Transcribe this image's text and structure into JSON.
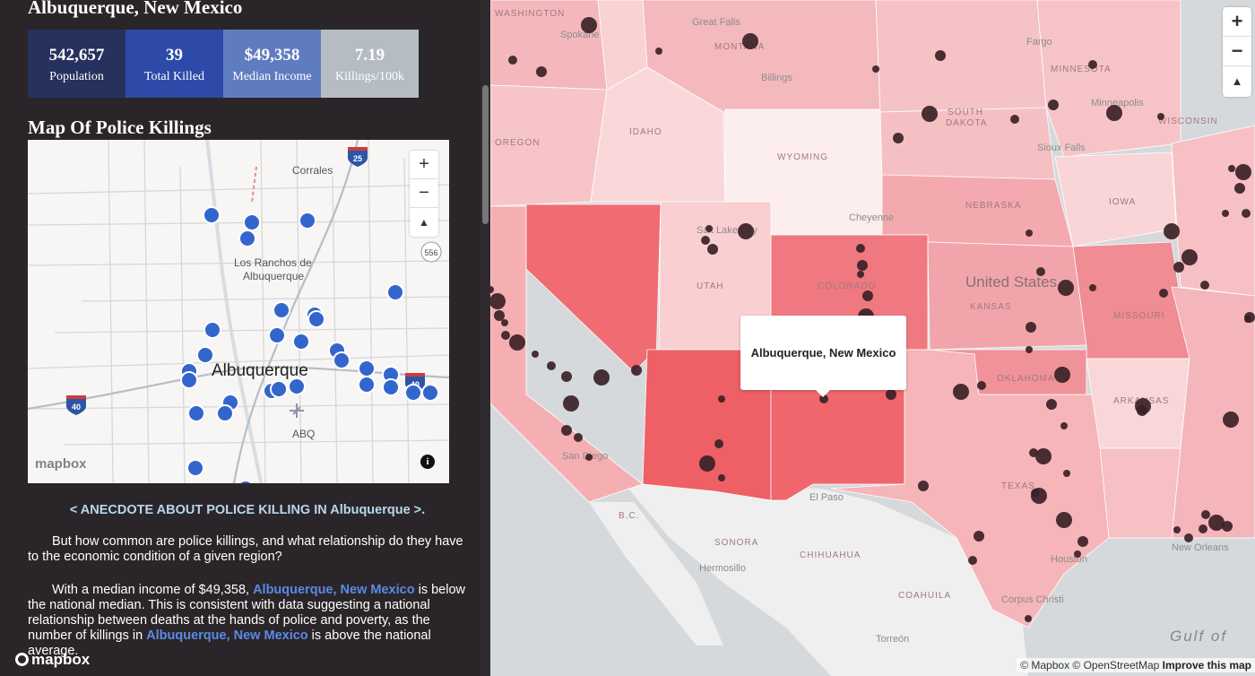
{
  "city": {
    "title": "Albuquerque, New Mexico"
  },
  "stats": [
    {
      "value": "542,657",
      "label": "Population",
      "color": "#27315e"
    },
    {
      "value": "39",
      "label": "Total Killed",
      "color": "#2d4aa8"
    },
    {
      "value": "$49,358",
      "label": "Median Income",
      "color": "#5f7cc0"
    },
    {
      "value": "7.19",
      "label": "Killings/100k",
      "color": "#b5bcc3"
    }
  ],
  "section_title": "Map Of Police Killings",
  "mini_map": {
    "labels": {
      "corrales": "Corrales",
      "los_ranchos_1": "Los Ranchos de",
      "los_ranchos_2": "Albuquerque",
      "albuquerque": "Albuquerque",
      "abq": "ABQ",
      "highway_25": "25",
      "highway_40a": "40",
      "highway_40b": "40",
      "highway_556": "556"
    },
    "zoom_in": "+",
    "zoom_out": "−",
    "compass": "▲",
    "logo": "mapbox",
    "info": "i",
    "marker_color": "#3366cc"
  },
  "anecdote": "< ANECDOTE ABOUT POLICE KILLING IN Albuquerque >.",
  "paragraphs": {
    "p1": "But how common are police killings, and what relationship do they have to the economic condition of a given region?",
    "p2_a": "With a median income of $49,358, ",
    "p2_link1": "Albuquerque, New Mexico",
    "p2_b": " is below the national median. This is consistent with data suggesting a national relationship between deaths at the hands of police and poverty, as the number of killings in ",
    "p2_link2": "Albuquerque, New Mexico",
    "p2_c": " is above the national average."
  },
  "bottom_logo": "mapbox",
  "main_map": {
    "zoom_in": "+",
    "zoom_out": "−",
    "compass": "▲",
    "popup_text": "Albuquerque, New Mexico",
    "attribution_1": "© Mapbox © OpenStreetMap",
    "attribution_2": "Improve this map",
    "gulf_label": "Gulf of",
    "country_label": "United States",
    "state_labels": {
      "washington": "WASHINGTON",
      "montana": "MONTANA",
      "minnesota": "MINNESOTA",
      "oregon": "OREGON",
      "idaho": "IDAHO",
      "wyoming": "WYOMING",
      "south_dakota_1": "SOUTH",
      "south_dakota_2": "DAKOTA",
      "wisconsin": "WISCONSIN",
      "iowa": "IOWA",
      "nebraska": "NEBRASKA",
      "utah": "UTAH",
      "colorado": "COLORADO",
      "kansas": "KANSAS",
      "missouri": "MISSOURI",
      "oklahoma": "OKLAHOMA",
      "arkansas": "ARKANSAS",
      "texas": "TEXAS",
      "sonora": "SONORA",
      "chihuahua": "CHIHUAHUA",
      "coahuila": "COAHUILA",
      "bc": "B.C."
    },
    "city_labels": {
      "great_falls": "Great Falls",
      "spokane": "Spokane",
      "billings": "Billings",
      "fargo": "Fargo",
      "minneapolis": "Minneapolis",
      "sioux_falls": "Sioux Falls",
      "cheyenne": "Cheyenne",
      "salt_lake": "Salt Lake City",
      "hermosillo": "Hermosillo",
      "el_paso": "El Paso",
      "torreon": "Torreón",
      "new_orleans": "New Orleans",
      "corpus_christi": "Corpus Christi",
      "san_diego": "San Diego",
      "houston": "Houston"
    },
    "dot_color": "#3a2226"
  }
}
